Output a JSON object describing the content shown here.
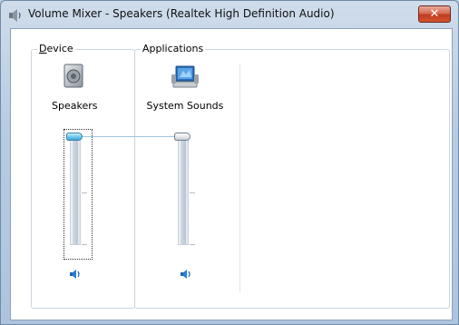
{
  "window": {
    "title": "Volume Mixer - Speakers (Realtek High Definition Audio)",
    "close_glyph": "✕",
    "icon": "speaker-app-icon"
  },
  "device_group": {
    "legend_first": "D",
    "legend_rest": "evice",
    "device_name": "Speakers",
    "icon": "speaker-device-icon",
    "volume": 1.0,
    "mute_icon": "speaker-volume-icon"
  },
  "applications_group": {
    "legend": "Applications",
    "apps": [
      {
        "name": "System Sounds",
        "icon": "system-sounds-icon",
        "volume": 1.0,
        "mute_icon": "speaker-volume-icon"
      }
    ]
  },
  "colors": {
    "accent": "#3fa9dc",
    "close_button": "#c23b1f",
    "titlebar": "#b7cbe2"
  }
}
